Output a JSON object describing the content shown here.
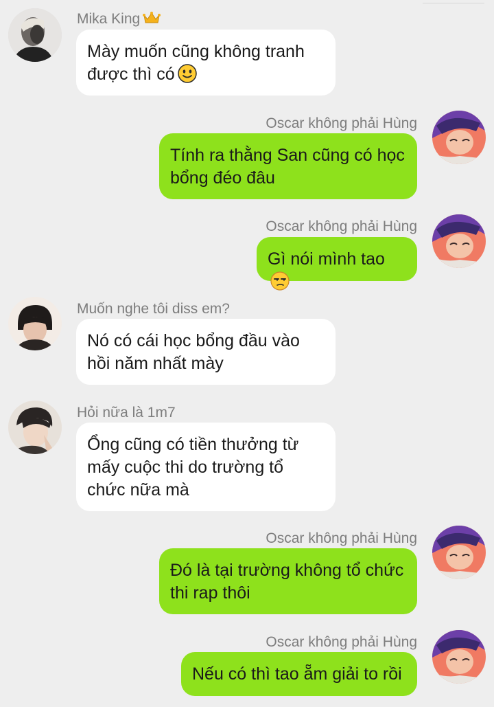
{
  "messages": [
    {
      "sender": "Mika King",
      "side": "left",
      "badge": "crown-icon",
      "lines": [
        "Mày muốn cũng không tranh",
        "được thì có"
      ],
      "emoji": "slightly-smiling-face-icon"
    },
    {
      "sender": "Oscar không phải Hùng",
      "side": "right",
      "lines": [
        "Tính ra thằng San cũng có học",
        "bổng đéo đâu"
      ]
    },
    {
      "sender": "Oscar không phải Hùng",
      "side": "right",
      "lines": [
        "Gì nói mình tao"
      ],
      "emoji": "unamused-face-icon"
    },
    {
      "sender": "Muốn nghe tôi diss em?",
      "side": "left",
      "lines": [
        "Nó có cái học bổng đầu vào",
        "hồi năm nhất mày"
      ]
    },
    {
      "sender": "Hỏi nữa là 1m7",
      "side": "left",
      "lines": [
        "Ổng cũng có tiền thưởng từ",
        "mấy cuộc thi do trường tổ",
        "chức nữa mà"
      ]
    },
    {
      "sender": "Oscar không phải Hùng",
      "side": "right",
      "lines": [
        "Đó là tại trường không tổ chức",
        "thi rap thôi"
      ]
    },
    {
      "sender": "Oscar không phải Hùng",
      "side": "right",
      "lines": [
        "Nếu có thì tao ẵm giải to rồi"
      ]
    }
  ],
  "colors": {
    "background": "#eeeeee",
    "incoming_bubble": "#ffffff",
    "outgoing_bubble": "#8ee11c",
    "sender_name": "#7d7d7d"
  }
}
